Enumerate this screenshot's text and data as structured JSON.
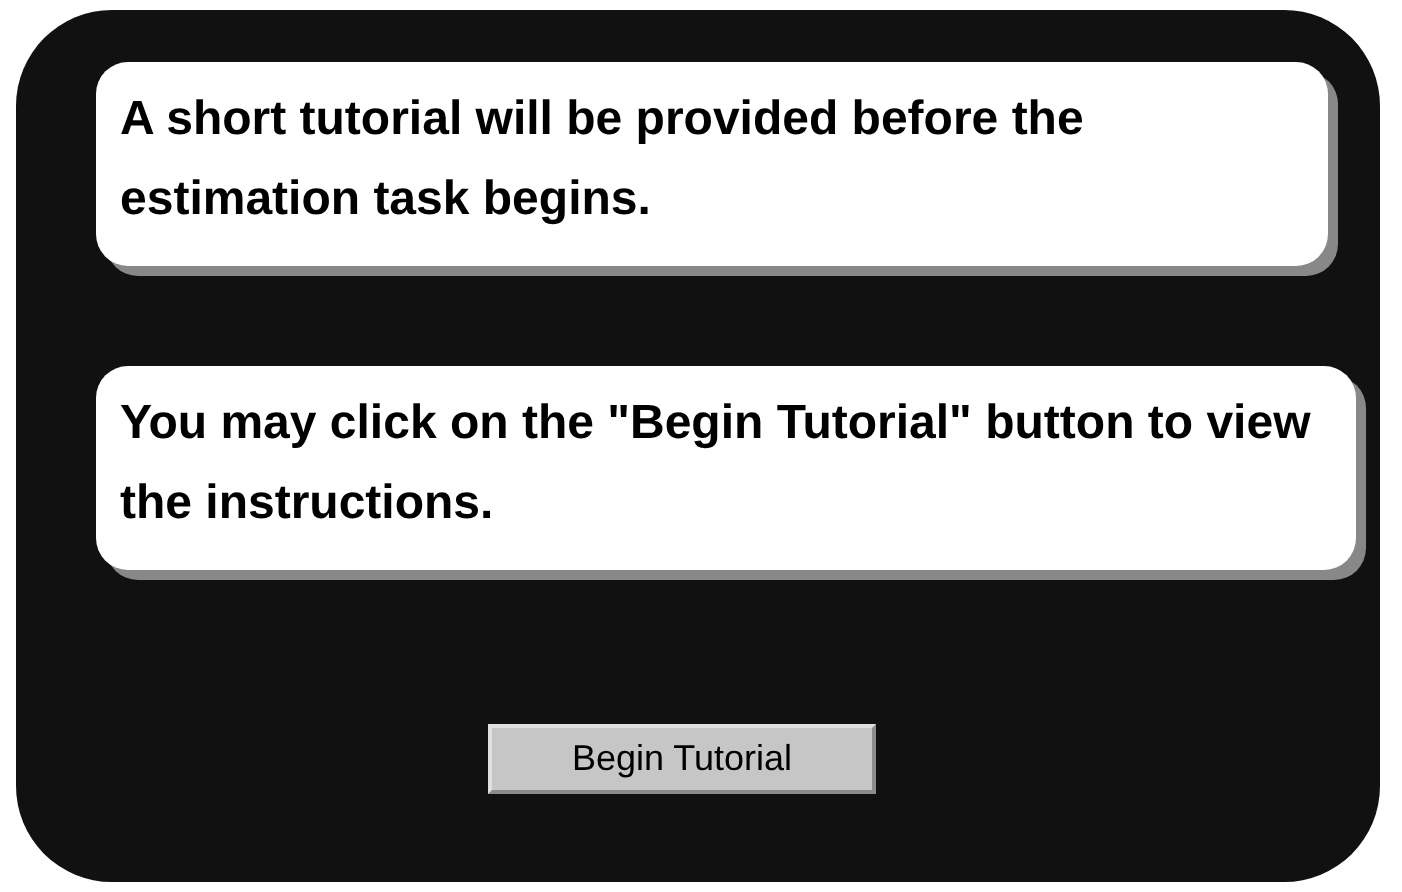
{
  "messages": [
    {
      "text": "A short tutorial will be provided before the estimation task begins."
    },
    {
      "text": "You may click on the \"Begin Tutorial\" button to view the instructions."
    }
  ],
  "button": {
    "label": "Begin Tutorial"
  }
}
